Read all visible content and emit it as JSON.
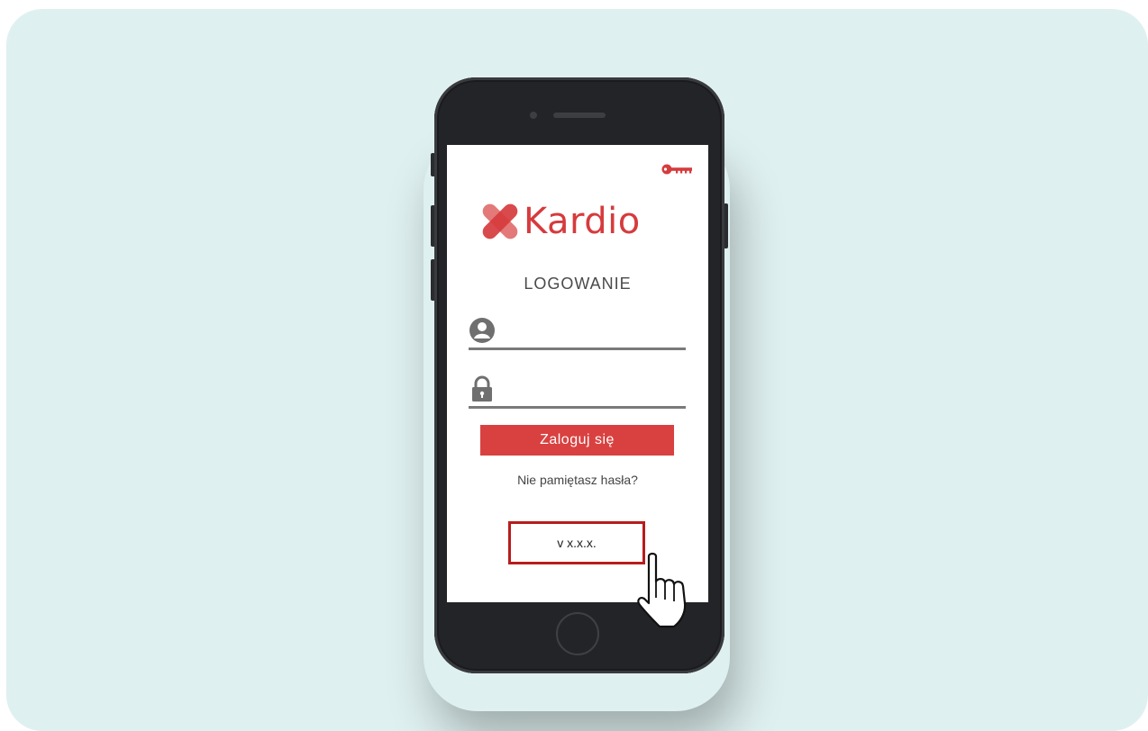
{
  "app": {
    "brand": "Kardio",
    "title": "LOGOWANIE"
  },
  "form": {
    "username_value": "",
    "password_value": "",
    "login_button": "Zaloguj się",
    "forgot_link": "Nie pamiętasz hasła?"
  },
  "footer": {
    "version": "v x.x.x."
  },
  "icons": {
    "key": "key-icon",
    "user": "user-icon",
    "lock": "lock-icon",
    "cursor": "hand-pointer-icon"
  },
  "colors": {
    "background": "#dff0f0",
    "brand": "#d63b3d",
    "button": "#d94140",
    "highlight": "#b81c1c",
    "phone": "#232427"
  }
}
